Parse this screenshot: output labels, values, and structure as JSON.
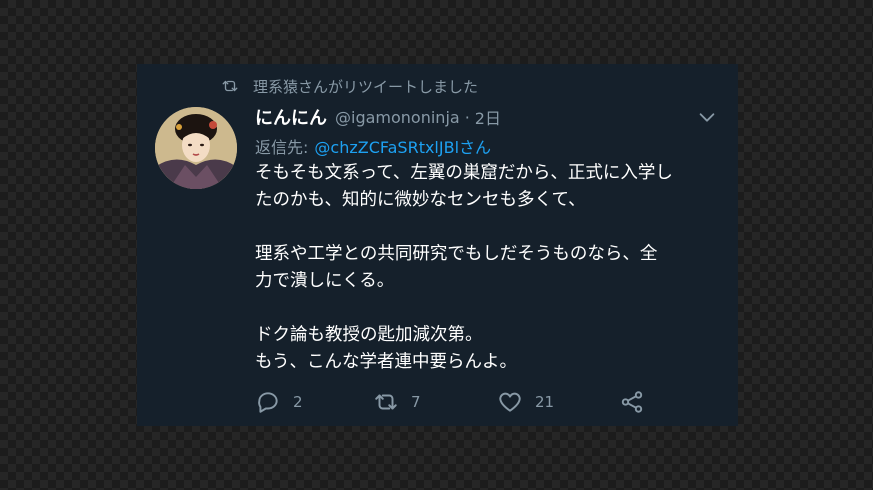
{
  "retweet": {
    "icon": "retweet-icon",
    "label": "理系猿さんがリツイートしました"
  },
  "tweet": {
    "display_name": "にんにん",
    "handle": "@igamononinja",
    "separator": "·",
    "time": "2日",
    "reply_prefix": "返信先:",
    "reply_handle": "@chzZCFaSRtxlJBlさん",
    "body": {
      "p1": [
        "そもそも文系って、左翼の巣窟だから、正式に入学し",
        "たのかも、知的に微妙なセンセも多くて、"
      ],
      "p2": [
        "理系や工学との共同研究でもしだそうものなら、全",
        "力で潰しにくる。"
      ],
      "p3": [
        "ドク論も教授の匙加減次第。",
        "もう、こんな学者連中要らんよ。"
      ]
    },
    "actions": {
      "reply_count": "2",
      "retweet_count": "7",
      "like_count": "21"
    }
  },
  "colors": {
    "card_bg": "#15202b",
    "text_primary": "#ffffff",
    "text_secondary": "#8899a6",
    "link": "#1da1f2"
  }
}
